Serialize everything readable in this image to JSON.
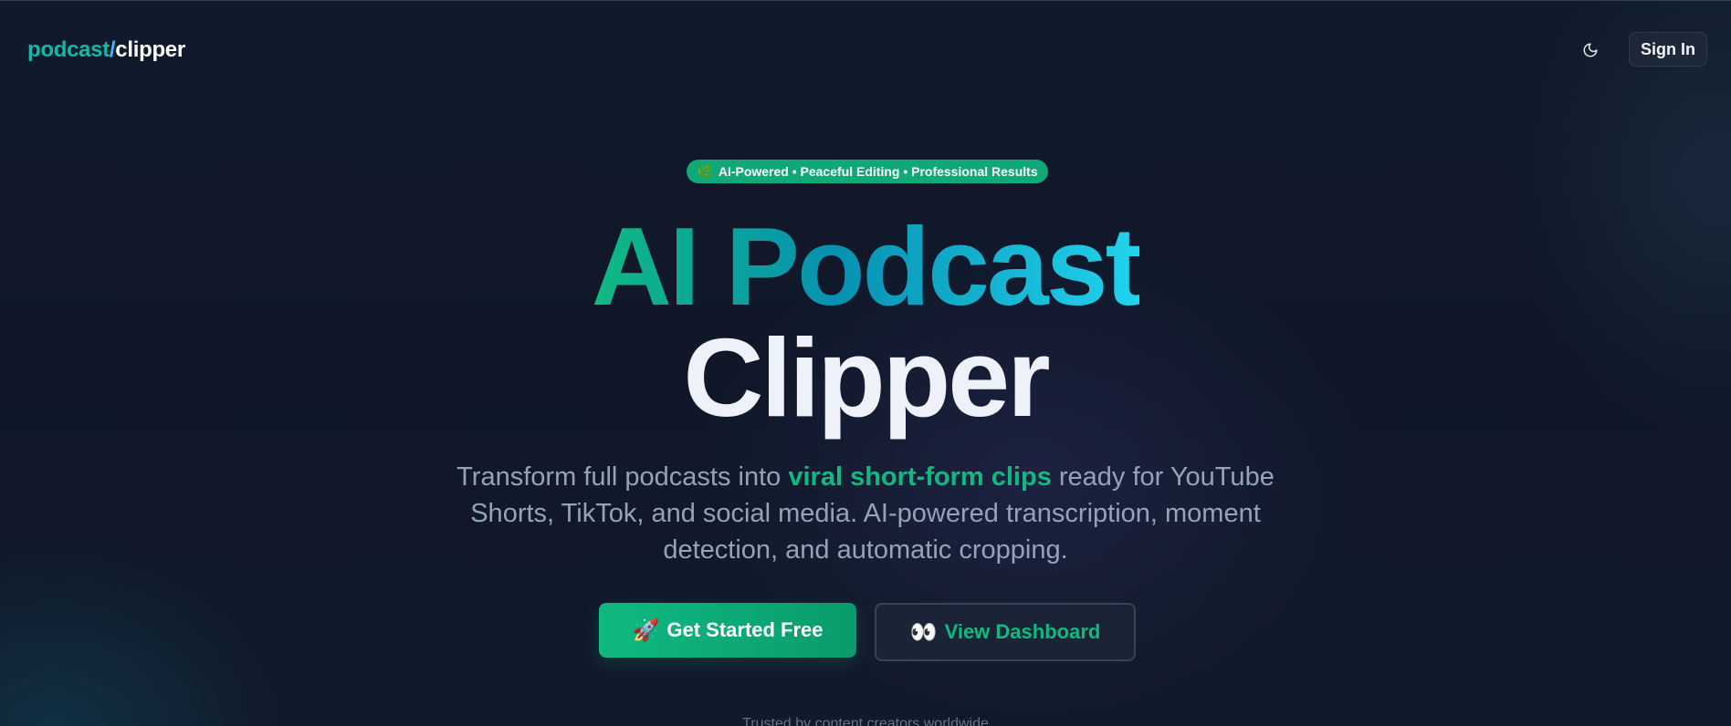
{
  "header": {
    "logo_part1": "podcast",
    "logo_separator": "/",
    "logo_part2": "clipper",
    "theme_toggle_icon": "moon-icon",
    "signin_label": "Sign In"
  },
  "hero": {
    "badge_icon": "🌿",
    "badge_text": "AI-Powered • Peaceful Editing • Professional Results",
    "title_line1": "AI Podcast",
    "title_line2": "Clipper",
    "subtitle_before": "Transform full podcasts into ",
    "subtitle_highlight": "viral short-form clips",
    "subtitle_after": " ready for YouTube Shorts, TikTok, and social media. AI-powered transcription, moment detection, and automatic cropping.",
    "primary_cta_icon": "🚀",
    "primary_cta_label": "Get Started Free",
    "secondary_cta_icon": "👀",
    "secondary_cta_label": "View Dashboard",
    "trusted_text": "Trusted by content creators worldwide"
  },
  "colors": {
    "accent": "#10b981",
    "background": "#0f1728",
    "title_gradient_start": "#10b981",
    "title_gradient_end": "#22d3ee"
  }
}
